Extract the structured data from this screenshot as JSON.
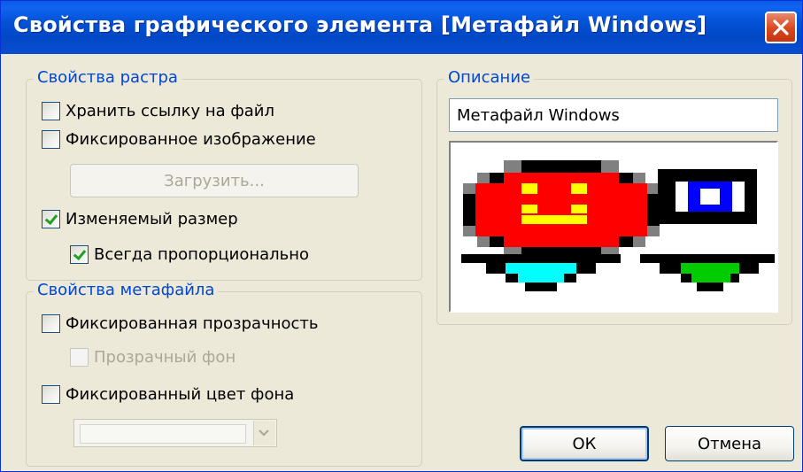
{
  "window": {
    "title": "Свойства графического элемента [Метафайл Windows]"
  },
  "raster": {
    "legend": "Свойства растра",
    "store_link": {
      "label": "Хранить ссылку на файл",
      "checked": false
    },
    "fixed_image": {
      "label": "Фиксированное изображение",
      "checked": false
    },
    "load_button": "Загрузить...",
    "resizable": {
      "label": "Изменяемый размер",
      "checked": true
    },
    "always_proportional": {
      "label": "Всегда пропорционально",
      "checked": true
    }
  },
  "metafile": {
    "legend": "Свойства метафайла",
    "fixed_transparency": {
      "label": "Фиксированная прозрачность",
      "checked": false
    },
    "transparent_bg": {
      "label": "Прозрачный фон",
      "checked": false
    },
    "fixed_bg_color": {
      "label": "Фиксированный цвет фона",
      "checked": false
    },
    "bg_color_value": ""
  },
  "description": {
    "legend": "Описание",
    "value": "Метафайл Windows"
  },
  "buttons": {
    "ok": "ОК",
    "cancel": "Отмена"
  },
  "colors": {
    "title_bar": "#0352d6",
    "group_legend": "#0046d5",
    "close_button": "#d9471f"
  }
}
